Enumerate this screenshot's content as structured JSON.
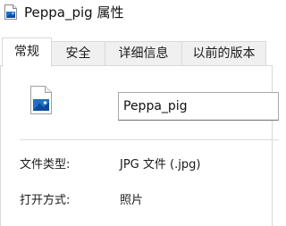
{
  "window": {
    "title": "Peppa_pig 属性",
    "icon": "image-file-icon"
  },
  "tabs": [
    {
      "label": "常规",
      "active": true
    },
    {
      "label": "安全",
      "active": false
    },
    {
      "label": "详细信息",
      "active": false
    },
    {
      "label": "以前的版本",
      "active": false
    }
  ],
  "general": {
    "file_icon": "image-file-icon",
    "file_name": "Peppa_pig",
    "file_type_label": "文件类型:",
    "file_type_value": "JPG 文件 (.jpg)",
    "open_with_label": "打开方式:",
    "open_with_value": "照片"
  },
  "colors": {
    "icon_blue": "#1e6fd0",
    "icon_dark_blue": "#0d4a9a",
    "icon_page": "#ffffff",
    "border": "#d9d9d9",
    "tab_inactive_bg": "#f0f0f0"
  }
}
